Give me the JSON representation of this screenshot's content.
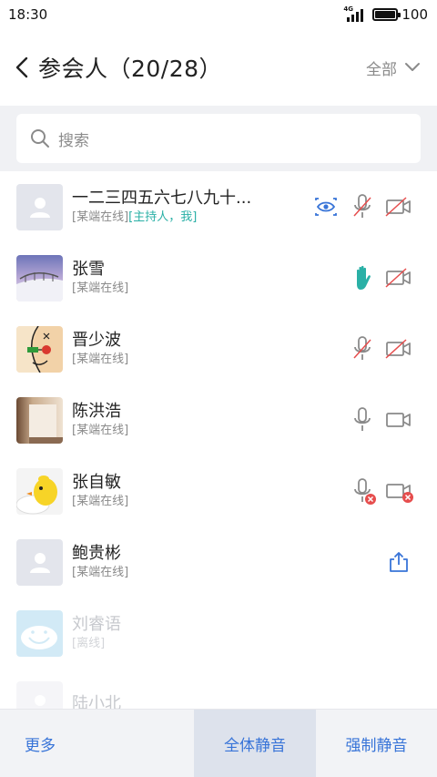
{
  "status_bar": {
    "time": "18:30",
    "network": "4G",
    "battery": "100"
  },
  "header": {
    "title": "参会人（20/28）",
    "filter_label": "全部"
  },
  "search": {
    "placeholder": "搜索"
  },
  "participants": [
    {
      "name": "一二三四五六七八九十...",
      "status": "[某端在线]",
      "tag": "[主持人，我]",
      "avatar": "placeholder",
      "icons": [
        "eye-icon",
        "mic-muted-icon",
        "camera-off-icon"
      ]
    },
    {
      "name": "张雪",
      "status": "[某端在线]",
      "avatar": "snow-bridge-photo",
      "icons": [
        "raise-hand-icon",
        "camera-off-icon"
      ]
    },
    {
      "name": "晋少波",
      "status": "[某端在线]",
      "avatar": "cartoon-face-photo",
      "icons": [
        "mic-muted-icon",
        "camera-off-icon"
      ]
    },
    {
      "name": "陈洪浩",
      "status": "[某端在线]",
      "avatar": "room-photo",
      "icons": [
        "mic-icon",
        "camera-icon"
      ]
    },
    {
      "name": "张自敏",
      "status": "[某端在线]",
      "avatar": "duck-photo",
      "icons": [
        "mic-error-icon",
        "camera-error-icon"
      ]
    },
    {
      "name": "鲍贵彬",
      "status": "[某端在线]",
      "avatar": "placeholder",
      "icons": [
        "share-icon"
      ]
    },
    {
      "name": "刘睿语",
      "status": "[离线]",
      "avatar": "smile-cloud-photo",
      "icons": []
    },
    {
      "name": "陆小北",
      "status": "",
      "avatar": "placeholder",
      "icons": []
    }
  ],
  "bottom_bar": {
    "more": "更多",
    "mute_all": "全体静音",
    "force_mute": "强制静音"
  },
  "colors": {
    "accent_blue": "#3874d8",
    "host_teal": "#2ab0a6",
    "muted_red": "#e64d4d",
    "icon_gray": "#8a8a8a"
  }
}
